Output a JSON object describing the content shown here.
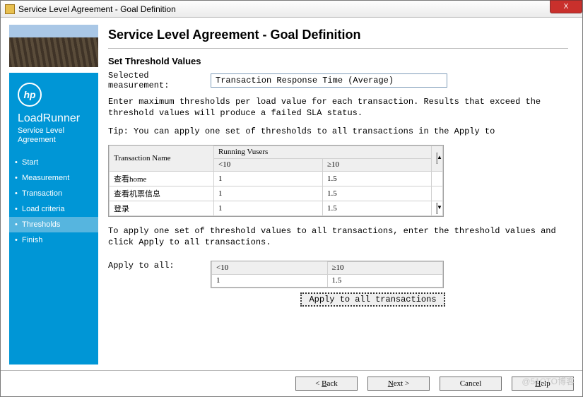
{
  "window": {
    "title": "Service Level Agreement - Goal Definition",
    "close": "X"
  },
  "sidebar": {
    "logo_text": "hp",
    "product": "LoadRunner",
    "subproduct": "Service Level Agreement",
    "items": [
      {
        "label": "Start"
      },
      {
        "label": "Measurement"
      },
      {
        "label": "Transaction"
      },
      {
        "label": "Load criteria"
      },
      {
        "label": "Thresholds"
      },
      {
        "label": "Finish"
      }
    ],
    "active_index": 4
  },
  "content": {
    "page_title": "Service Level Agreement - Goal Definition",
    "section_head": "Set Threshold Values",
    "selected_label": "Selected measurement:",
    "selected_value": "Transaction Response Time (Average)",
    "instr1": "Enter maximum thresholds per load value for each transaction.  Results that exceed the threshold values will produce a failed SLA status.",
    "tip": "Tip: You can apply one set of thresholds to all transactions in the Apply to",
    "running_header": "Running Vusers",
    "cols": {
      "name": "Transaction Name",
      "low": "<10",
      "high": "≥10"
    },
    "rows": [
      {
        "name": "查看home",
        "low": "1",
        "high": "1.5"
      },
      {
        "name": "查看机票信息",
        "low": "1",
        "high": "1.5"
      },
      {
        "name": "登录",
        "low": "1",
        "high": "1.5"
      }
    ],
    "apply_instr": "To apply one set of threshold values to all transactions, enter the threshold values and click Apply to all transactions.",
    "apply_label": "Apply to all:",
    "apply_cols": {
      "low": "<10",
      "high": "≥10"
    },
    "apply_vals": {
      "low": "1",
      "high": "1.5"
    },
    "apply_btn": "Apply to all transactions"
  },
  "footer": {
    "back": "Back",
    "next": "Next",
    "cancel": "Cancel",
    "help": "Help"
  },
  "watermark": "@51CTO博客"
}
